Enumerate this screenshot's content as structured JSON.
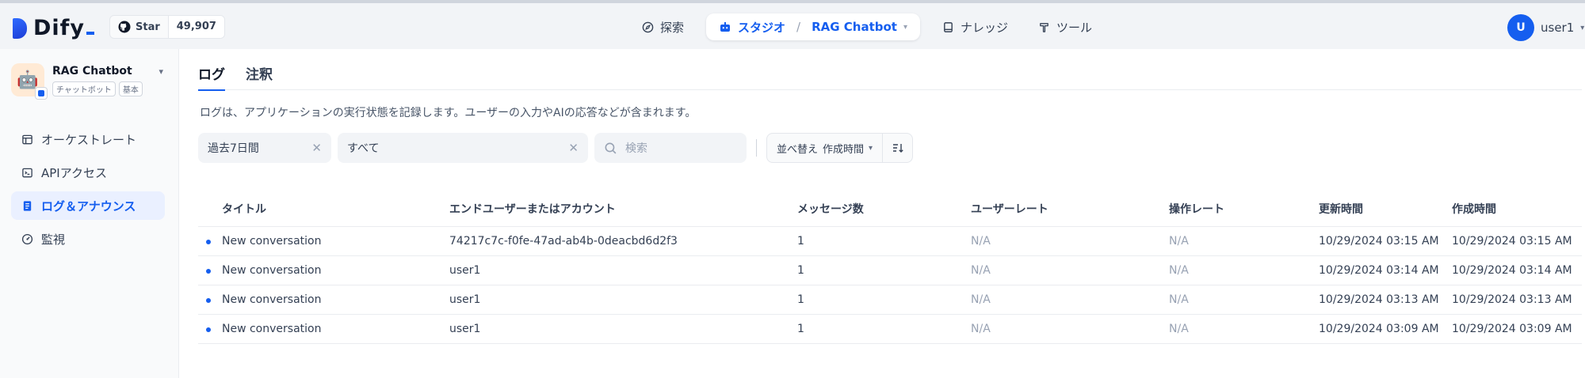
{
  "header": {
    "brand": "Dify",
    "github": {
      "label": "Star",
      "count": "49,907"
    },
    "nav": [
      {
        "label": "探索",
        "icon": "compass-icon"
      },
      {
        "label": "スタジオ",
        "icon": "robot-icon",
        "sub": "RAG Chatbot"
      },
      {
        "label": "ナレッジ",
        "icon": "book-icon"
      },
      {
        "label": "ツール",
        "icon": "hammer-icon"
      }
    ],
    "user": {
      "initial": "U",
      "name": "user1"
    }
  },
  "sidebar": {
    "app": {
      "name": "RAG Chatbot",
      "type": "チャットボット",
      "mode": "基本"
    },
    "items": [
      {
        "label": "オーケストレート",
        "icon": "layout-icon"
      },
      {
        "label": "APIアクセス",
        "icon": "terminal-icon"
      },
      {
        "label": "ログ＆アナウンス",
        "icon": "document-icon",
        "active": true
      },
      {
        "label": "監視",
        "icon": "gauge-icon"
      }
    ]
  },
  "main": {
    "tabs": [
      {
        "label": "ログ",
        "active": true
      },
      {
        "label": "注釈"
      }
    ],
    "description": "ログは、アプリケーションの実行状態を記録します。ユーザーの入力やAIの応答などが含まれます。",
    "filters": {
      "period": "過去7日間",
      "status": "すべて",
      "search_placeholder": "検索",
      "sort_prefix": "並べ替え",
      "sort_value": "作成時間"
    },
    "table": {
      "columns": [
        "タイトル",
        "エンドユーザーまたはアカウント",
        "メッセージ数",
        "ユーザーレート",
        "操作レート",
        "更新時間",
        "作成時間"
      ],
      "rows": [
        [
          "New conversation",
          "74217c7c-f0fe-47ad-ab4b-0deacbd6d2f3",
          "1",
          "N/A",
          "N/A",
          "10/29/2024 03:15 AM",
          "10/29/2024 03:15 AM"
        ],
        [
          "New conversation",
          "user1",
          "1",
          "N/A",
          "N/A",
          "10/29/2024 03:14 AM",
          "10/29/2024 03:14 AM"
        ],
        [
          "New conversation",
          "user1",
          "1",
          "N/A",
          "N/A",
          "10/29/2024 03:13 AM",
          "10/29/2024 03:13 AM"
        ],
        [
          "New conversation",
          "user1",
          "1",
          "N/A",
          "N/A",
          "10/29/2024 03:09 AM",
          "10/29/2024 03:09 AM"
        ]
      ]
    }
  },
  "colors": {
    "accent": "#155eef",
    "muted": "#98a2b3"
  }
}
